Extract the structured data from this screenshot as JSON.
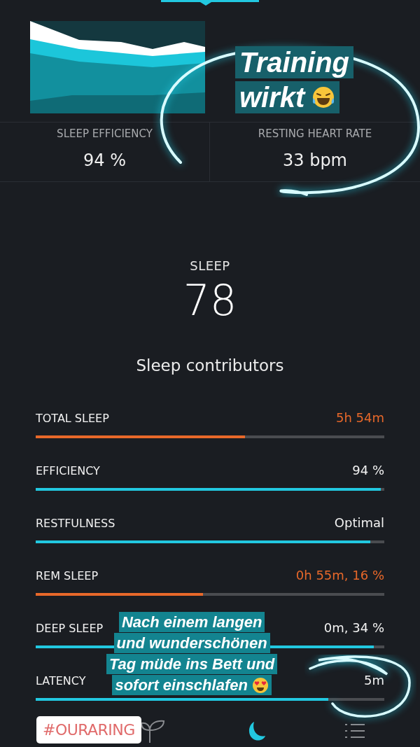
{
  "stats": [
    {
      "label": "SLEEP EFFICIENCY",
      "value": "94 %"
    },
    {
      "label": "RESTING HEART RATE",
      "value": "33 bpm"
    }
  ],
  "score": {
    "label": "SLEEP",
    "value": "78"
  },
  "contributors_title": "Sleep contributors",
  "contributors": [
    {
      "label": "TOTAL SLEEP",
      "value": "5h 54m",
      "level": 0.6,
      "color": "#e8682a"
    },
    {
      "label": "EFFICIENCY",
      "value": "94 %",
      "level": 0.99,
      "color": "#22c8e0"
    },
    {
      "label": "RESTFULNESS",
      "value": "Optimal",
      "level": 0.96,
      "color": "#22c8e0"
    },
    {
      "label": "REM SLEEP",
      "value": "0h 55m, 16 %",
      "level": 0.48,
      "color": "#e8682a"
    },
    {
      "label": "DEEP SLEEP",
      "value": "0m, 34 %",
      "level": 0.97,
      "color": "#22c8e0"
    },
    {
      "label": "LATENCY",
      "value": "5m",
      "level": 0.84,
      "color": "#22c8e0"
    }
  ],
  "nav": [
    {
      "kind": "leaf",
      "selected": false
    },
    {
      "kind": "moon",
      "selected": true
    },
    {
      "kind": "list",
      "selected": false
    }
  ],
  "stickers": {
    "top": [
      "Training",
      "wirkt"
    ],
    "bottom": [
      "Nach einem langen",
      "und wunderschönen",
      "Tag müde ins Bett und",
      "sofort einschlafen"
    ],
    "hashtag": "#OURARING"
  }
}
